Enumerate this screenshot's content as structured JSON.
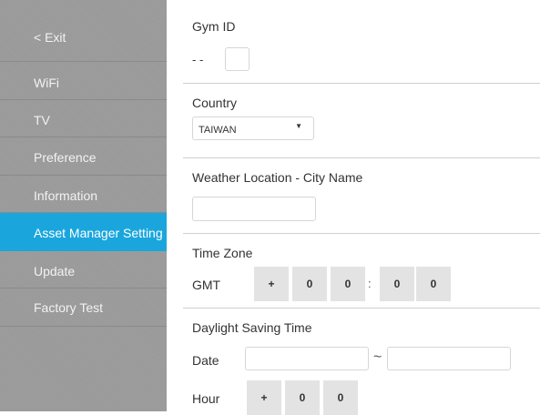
{
  "sidebar": {
    "exit_label": "< Exit",
    "items": [
      {
        "label": "WiFi"
      },
      {
        "label": "TV"
      },
      {
        "label": "Preference"
      },
      {
        "label": "Information"
      },
      {
        "label": "Asset Manager Setting",
        "active": true
      },
      {
        "label": "Update"
      },
      {
        "label": "Factory Test"
      }
    ]
  },
  "gym_id": {
    "title": "Gym ID",
    "prefix": "- -",
    "value": ""
  },
  "country": {
    "title": "Country",
    "selected": "TAIWAN",
    "caret_icon": "caret-down-icon"
  },
  "weather": {
    "title": "Weather Location - City Name",
    "value": ""
  },
  "time_zone": {
    "title": "Time Zone",
    "label": "GMT",
    "sign": "+",
    "hour_tens": "0",
    "hour_ones": "0",
    "separator": ":",
    "min_tens": "0",
    "min_ones": "0"
  },
  "dst": {
    "title": "Daylight Saving Time",
    "date_label": "Date",
    "date_start": "",
    "range_separator": "~",
    "date_end": "",
    "hour_label": "Hour",
    "sign": "+",
    "hour_tens": "0",
    "hour_ones": "0"
  },
  "colors": {
    "sidebar_bg": "#9a9a9a",
    "active_item": "#1aa6dd",
    "chip_bg": "#e3e3e3"
  }
}
